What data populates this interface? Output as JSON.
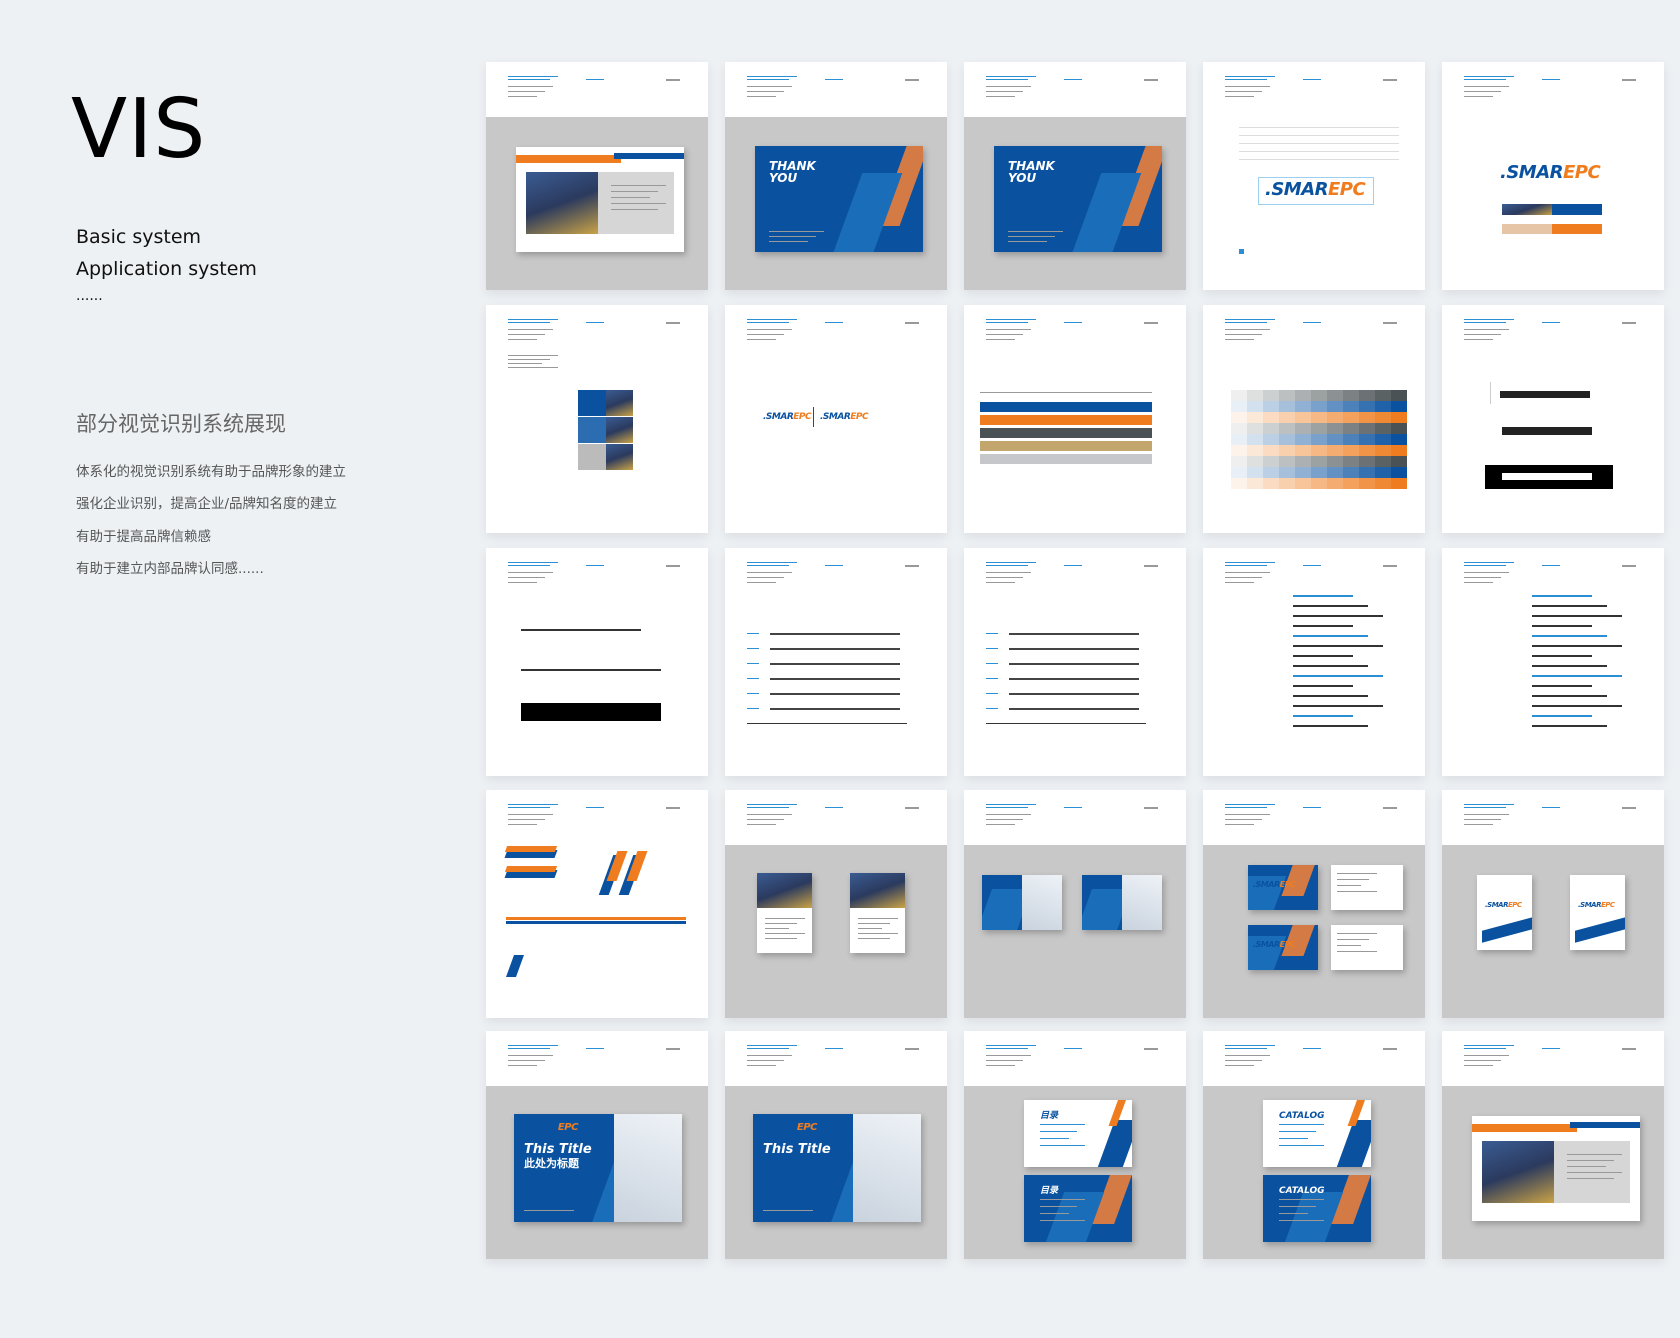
{
  "intro": {
    "title": "VIS",
    "systems": [
      "Basic system",
      "Application system",
      "......"
    ],
    "heading": "部分视觉识别系统展现",
    "points": [
      "体系化的视觉识别系统有助于品牌形象的建立",
      "强化企业识别，提高企业/品牌知名度的建立",
      "有助于提高品牌信赖感",
      "有助于建立内部品牌认同感......"
    ]
  },
  "colors": {
    "brand_blue": "#0a52a0",
    "brand_orange": "#ef7d1f",
    "page_bg": "#edf1f4",
    "mount_grey": "#c8c8c8"
  },
  "logo": {
    "part1": ".SMAR",
    "part2": "EPC"
  },
  "cards": [
    {
      "type": "about",
      "bg": "grey"
    },
    {
      "type": "thanks",
      "bg": "grey",
      "title": "THANK YOU"
    },
    {
      "type": "thanks",
      "bg": "grey",
      "title": "THANK YOU"
    },
    {
      "type": "logo-grid",
      "bg": "white"
    },
    {
      "type": "logo-colors",
      "bg": "white"
    },
    {
      "type": "photos",
      "bg": "white"
    },
    {
      "type": "logo-pair",
      "bg": "white"
    },
    {
      "type": "color-bars",
      "bg": "white"
    },
    {
      "type": "color-matrix",
      "bg": "white"
    },
    {
      "type": "company-names",
      "bg": "white"
    },
    {
      "type": "lines",
      "bg": "white"
    },
    {
      "type": "text-rows",
      "bg": "white"
    },
    {
      "type": "text-rows",
      "bg": "white"
    },
    {
      "type": "fonts",
      "bg": "white"
    },
    {
      "type": "fonts",
      "bg": "white"
    },
    {
      "type": "shapes",
      "bg": "white"
    },
    {
      "type": "brochures",
      "bg": "grey"
    },
    {
      "type": "slides2",
      "bg": "grey"
    },
    {
      "type": "cards2",
      "bg": "grey"
    },
    {
      "type": "bags",
      "bg": "grey"
    },
    {
      "type": "title-slide",
      "bg": "grey",
      "title": "This Title",
      "subtitle": "此处为标题"
    },
    {
      "type": "title-slide",
      "bg": "grey",
      "title": "This Title",
      "subtitle": ""
    },
    {
      "type": "toc",
      "bg": "grey",
      "title": "目录"
    },
    {
      "type": "toc",
      "bg": "grey",
      "title": "CATALOG"
    },
    {
      "type": "about",
      "bg": "grey"
    }
  ]
}
